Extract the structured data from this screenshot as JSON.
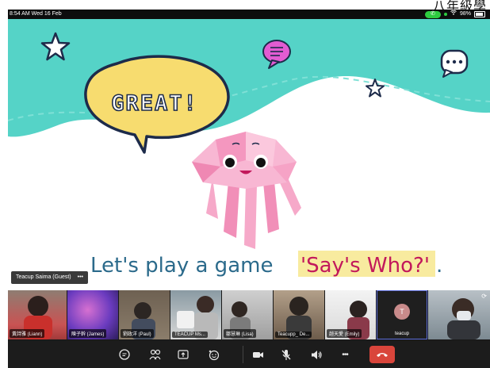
{
  "corner_text": "八年級學",
  "status_bar": {
    "time": "8:54 AM  Wed 16 Feb",
    "battery": "98%"
  },
  "slide": {
    "great_text": "GREAT!",
    "prompt_text": "Let's play a game",
    "highlight_text": "'Say's Who?'",
    "period": ".",
    "colors": {
      "wave": "#55d3c7",
      "bubble": "#f7dc6f",
      "prompt": "#2b6a8b",
      "highlight_bg": "#f8eb9f",
      "highlight_text": "#c2185b"
    }
  },
  "presenter_tag": {
    "name": "Teacup Saima (Guest)",
    "more": "•••"
  },
  "participants": [
    {
      "name": "黃詩雅 (Liann)"
    },
    {
      "name": "陳子幹 (James)"
    },
    {
      "name": "劉政洋 (Paul)"
    },
    {
      "name": "TEACUP Ms..."
    },
    {
      "name": "鄒慧琳 (Lisa)"
    },
    {
      "name": "Teacupp_ De..."
    },
    {
      "name": "趙天愛 (Emily)"
    },
    {
      "name": "teacup",
      "initial": "T"
    },
    {
      "name": ""
    }
  ],
  "toolbar": {
    "chat_icon": "chat-icon",
    "participants_icon": "participants-icon",
    "share_icon": "share-screen-icon",
    "reactions_icon": "reactions-icon",
    "video_icon": "video-camera-icon",
    "mic_icon": "microphone-muted-icon",
    "speaker_icon": "speaker-icon",
    "more_label": "•••",
    "leave_icon": "phone-hangup-icon"
  }
}
